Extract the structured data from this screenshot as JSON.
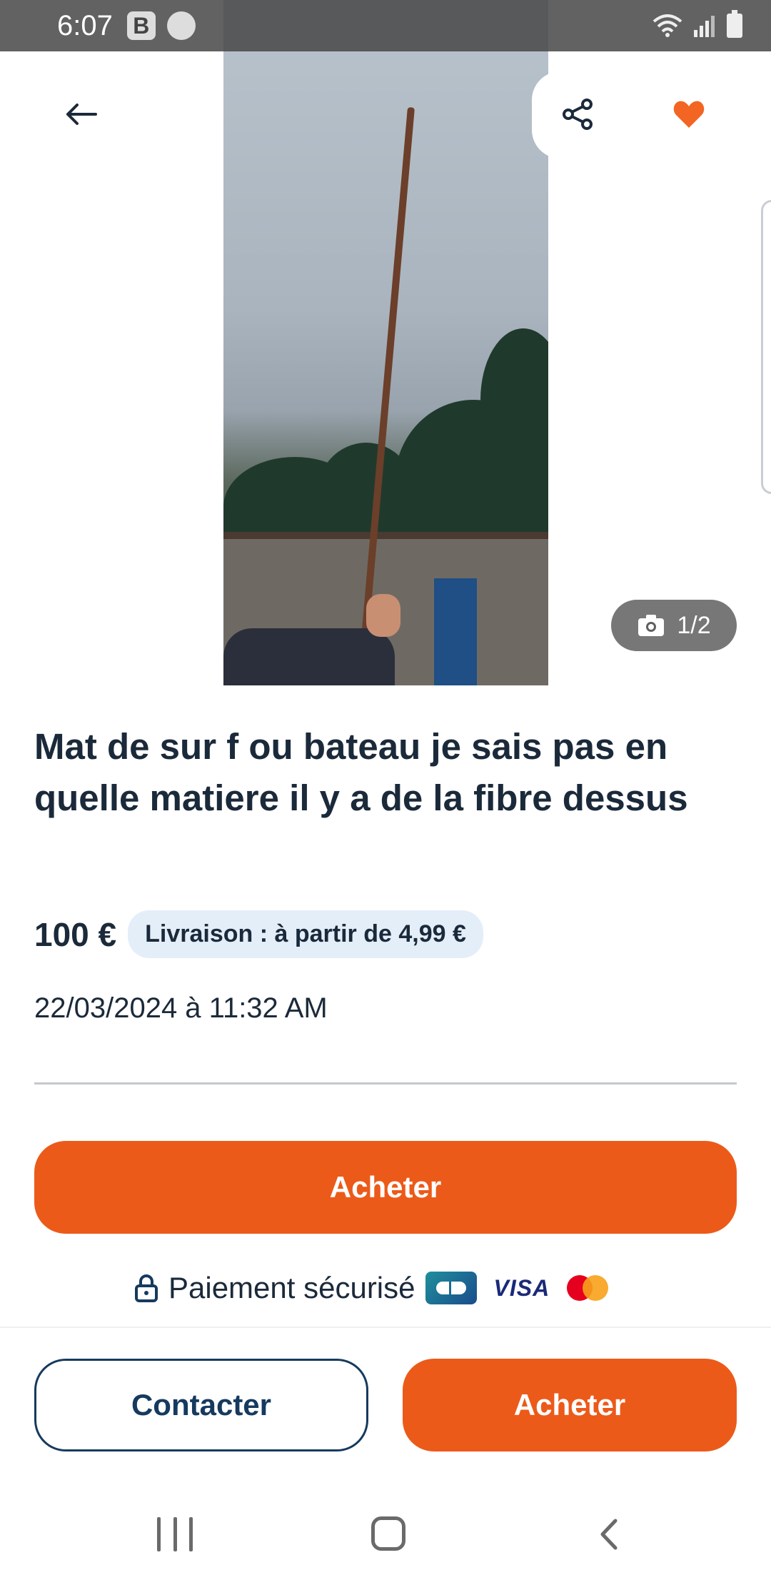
{
  "status_bar": {
    "time": "6:07",
    "badge_letter": "B"
  },
  "listing": {
    "title": "Mat de sur f ou bateau je sais pas en quelle matiere il y a de la fibre dessus",
    "price": "100 €",
    "delivery": "Livraison : à partir de 4,99 €",
    "date": "22/03/2024 à 11:32 AM",
    "photo_counter": "1/2"
  },
  "actions": {
    "buy_main": "Acheter",
    "secure_payment": "Paiement sécurisé",
    "contact": "Contacter",
    "buy_secondary": "Acheter"
  },
  "payment_logos": {
    "visa": "VISA"
  },
  "colors": {
    "accent": "#ec5a19",
    "navy": "#163a5f",
    "heart": "#f26522"
  },
  "icons": [
    "back-arrow-icon",
    "share-icon",
    "heart-icon",
    "camera-icon",
    "lock-icon"
  ]
}
